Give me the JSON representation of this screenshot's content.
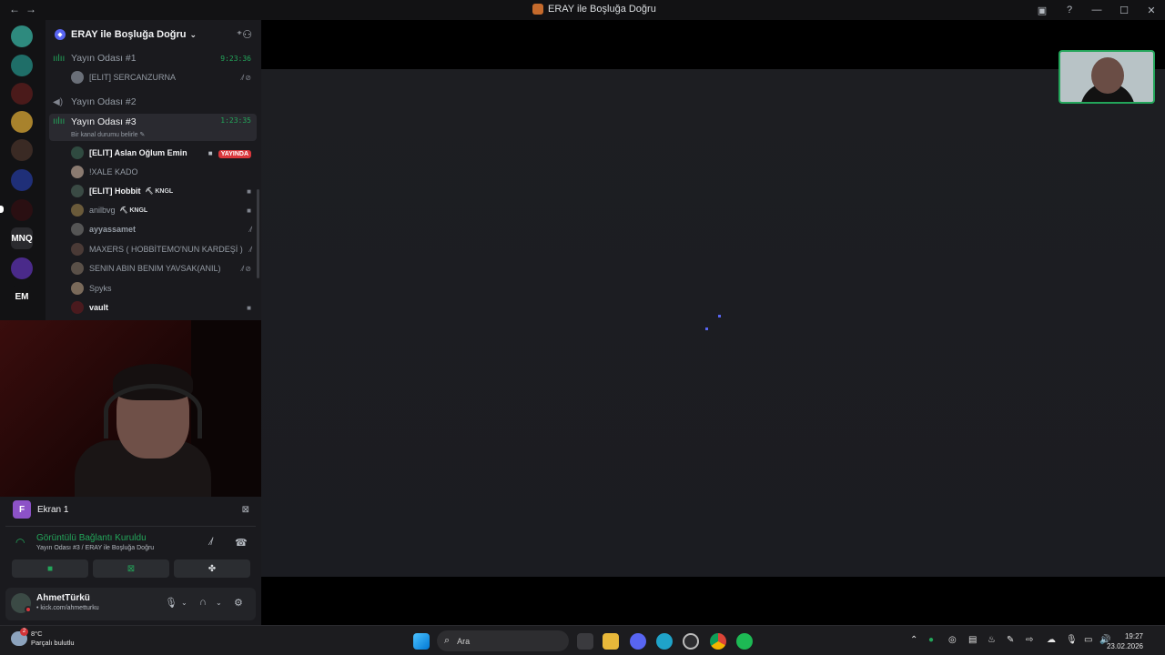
{
  "window": {
    "title": "ERAY ile Boşluğa Doğru",
    "nav_back": "←",
    "nav_forward": "→"
  },
  "server": {
    "name": "ERAY ile Boşluğa Doğru",
    "chevron": "⌄",
    "invite_icon": "person-add-icon"
  },
  "rail": {
    "labels": [
      "MNQ",
      "EM"
    ]
  },
  "channels": [
    {
      "name": "Yayın Odası #1",
      "timer": "9:23:36",
      "icon": "voice-active-icon"
    },
    {
      "name": "Yayın Odası #2",
      "timer": "",
      "icon": "voice-muted-icon"
    },
    {
      "name": "Yayın Odası #3",
      "timer": "1:23:35",
      "status": "Bir kanal durumu belirle",
      "icon": "voice-active-icon"
    }
  ],
  "channel1_members": [
    {
      "name": "[ELIT] SERCANZURNA"
    }
  ],
  "members": [
    {
      "name": "[ELIT] Aslan Oğlum Emin",
      "live": "YAYINDA",
      "bright": true
    },
    {
      "name": "!XALE KADO",
      "bright": false
    },
    {
      "name": "[ELIT] Hobbit",
      "tag": "KNGL",
      "bright": true
    },
    {
      "name": "anilbvg",
      "tag": "KNGL",
      "bright": false
    },
    {
      "name": "ayyassamet",
      "bright": false
    },
    {
      "name": "MAXERS ( HOBBİTEMO'NUN KARDEŞİ )",
      "bright": false
    },
    {
      "name": "SENIN ABIN BENIM YAVSAK(ANIL)",
      "bright": false
    },
    {
      "name": "Spyks",
      "bright": false
    },
    {
      "name": "vault",
      "bright": true
    }
  ],
  "screen_share": {
    "avatar_letter": "F",
    "label": "Ekran 1"
  },
  "voice": {
    "status": "Görüntülü Bağlantı Kuruldu",
    "location": "Yayın Odası #3 / ERAY ile Boşluğa Doğru"
  },
  "user": {
    "name": "AhmetTürkü",
    "status": "• kick.com/ahmetturku"
  },
  "taskbar": {
    "temp": "8°C",
    "weather": "Parçalı bulutlu",
    "weather_badge": "2",
    "search_placeholder": "Ara",
    "time": "19:27",
    "date": "23.02.2026"
  },
  "colors": {
    "accent": "#5865f2",
    "online": "#23a55a",
    "live": "#da373c"
  }
}
